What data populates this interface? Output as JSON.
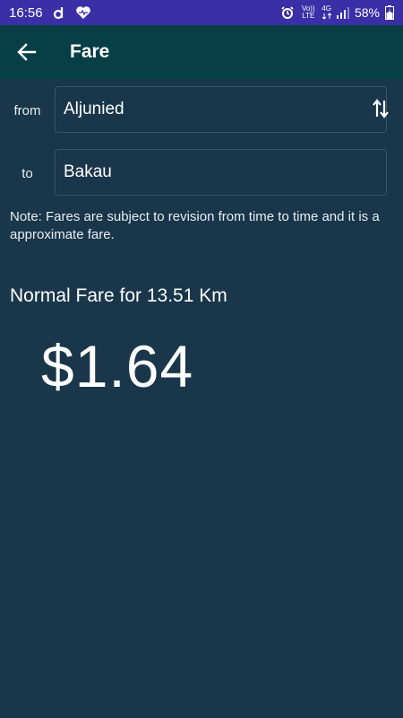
{
  "status_bar": {
    "time": "16:56",
    "notif_icons": [
      "d-app-icon",
      "heart-icon"
    ],
    "volte": "Vo)) LTE",
    "network": "4G",
    "battery": "58%"
  },
  "app_bar": {
    "title": "Fare",
    "background": "#073f47"
  },
  "form": {
    "from_label": "from",
    "from_value": "Aljunied",
    "to_label": "to",
    "to_value": "Bakau"
  },
  "note": "Note: Fares are subject to revision from time to time and it is a approximate fare.",
  "fare": {
    "title": "Normal Fare for 13.51 Km",
    "amount": "$1.64"
  },
  "colors": {
    "status_bar": "#3a2fa6",
    "background": "#19364a"
  }
}
